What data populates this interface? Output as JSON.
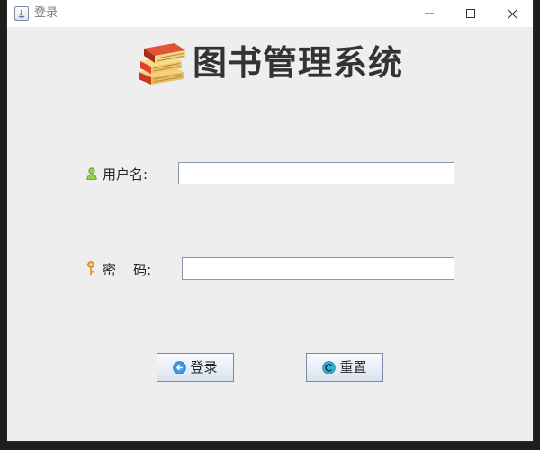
{
  "window": {
    "title": "登录"
  },
  "header": {
    "app_title": "图书管理系统",
    "icon": "books-icon"
  },
  "form": {
    "username": {
      "label": "用户名:",
      "icon": "user-icon",
      "value": ""
    },
    "password": {
      "label": "密    码:",
      "icon": "key-icon",
      "value": ""
    }
  },
  "buttons": {
    "login": {
      "label": "登录",
      "icon": "login-arrow-icon"
    },
    "reset": {
      "label": "重置",
      "icon": "reset-icon"
    }
  },
  "colors": {
    "window_bg": "#eeeeee",
    "titlebar_bg": "#ffffff",
    "heading_text": "#333333",
    "input_border": "#8a98ad"
  }
}
